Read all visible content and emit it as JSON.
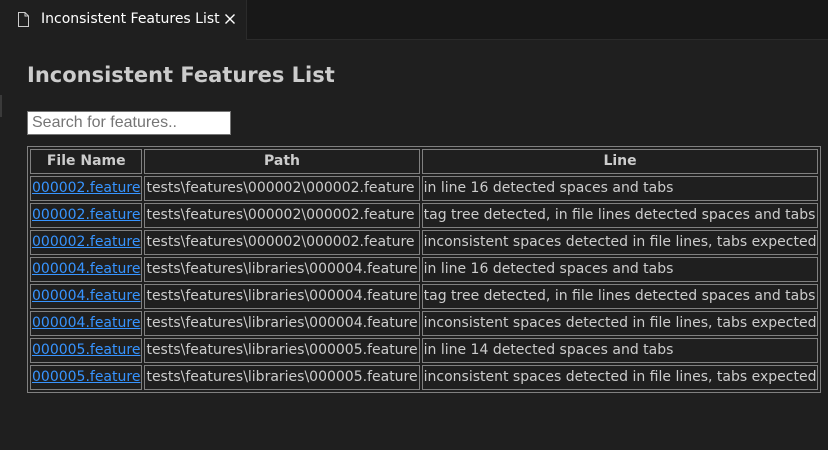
{
  "tab": {
    "label": "Inconsistent Features List",
    "icon": "file-icon",
    "close_icon": "close-icon"
  },
  "page": {
    "title": "Inconsistent Features List"
  },
  "search": {
    "placeholder": "Search for features..",
    "value": ""
  },
  "table": {
    "headers": [
      "File Name",
      "Path",
      "Line"
    ],
    "rows": [
      {
        "file": "000002.feature",
        "path": "tests\\features\\000002\\000002.feature",
        "line": "in line 16 detected spaces and tabs"
      },
      {
        "file": "000002.feature",
        "path": "tests\\features\\000002\\000002.feature",
        "line": "tag tree detected, in file lines detected spaces and tabs"
      },
      {
        "file": "000002.feature",
        "path": "tests\\features\\000002\\000002.feature",
        "line": "inconsistent spaces detected in file lines, tabs expected"
      },
      {
        "file": "000004.feature",
        "path": "tests\\features\\libraries\\000004.feature",
        "line": "in line 16 detected spaces and tabs"
      },
      {
        "file": "000004.feature",
        "path": "tests\\features\\libraries\\000004.feature",
        "line": "tag tree detected, in file lines detected spaces and tabs"
      },
      {
        "file": "000004.feature",
        "path": "tests\\features\\libraries\\000004.feature",
        "line": "inconsistent spaces detected in file lines, tabs expected"
      },
      {
        "file": "000005.feature",
        "path": "tests\\features\\libraries\\000005.feature",
        "line": "in line 14 detected spaces and tabs"
      },
      {
        "file": "000005.feature",
        "path": "tests\\features\\libraries\\000005.feature",
        "line": "inconsistent spaces detected in file lines, tabs expected"
      }
    ]
  },
  "colors": {
    "background": "#1f1f1f",
    "link": "#3794ff",
    "text": "#cccccc",
    "border": "#808080"
  }
}
